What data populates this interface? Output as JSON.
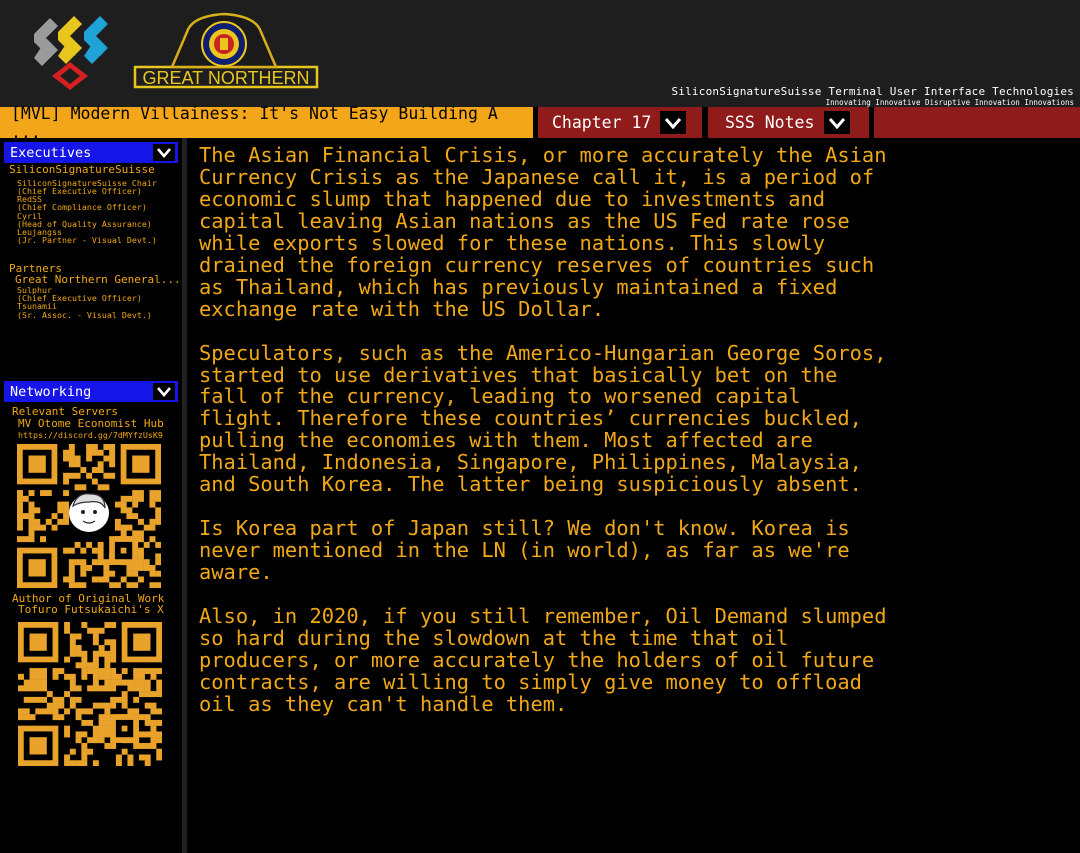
{
  "header": {
    "logo_alt": "SSS logo",
    "publisher_logo_text": "GREAT NORTHERN",
    "company_name": "SiliconSignatureSuisse Terminal User Interface Technologies",
    "company_tagline": "Innovating Innovative Disruptive Innovation Innovations"
  },
  "tabs": {
    "title": "[MVL] Modern Villainess: It's Not Easy Building A ...",
    "chapter": "Chapter 17",
    "notes": "SSS Notes"
  },
  "sidebar": {
    "executives": {
      "label": "Executives",
      "group1": "SiliconSignatureSuisse",
      "group1_items": [
        "SiliconSignatureSuisse Chair",
        "(Chief Executive Officer)",
        "RedSS",
        "(Chief Compliance Officer)",
        "Cyril",
        "(Head of Quality Assurance)",
        "Leujangss",
        "(Jr. Partner - Visual Devt.)"
      ],
      "group2": "Partners",
      "group2_sub": "Great Northern General...",
      "group2_items": [
        "Sulphur",
        "(Chief Executive Officer)",
        "Tsunamii",
        "(Sr. Assoc. - Visual Devt.)"
      ]
    },
    "networking": {
      "label": "Networking",
      "servers_label": "Relevant Servers",
      "server_name": "MV Otome Economist Hub",
      "server_url": "https://discord.gg/7dMYfzUsK9",
      "author_label": "Author of Original Work",
      "author_name": "Tofuro Futsukaichi's X"
    }
  },
  "content": {
    "paragraphs": [
      [
        "The Asian Financial Crisis, or more accurately the Asian",
        "Currency Crisis as the Japanese call it, is a period of",
        "economic slump that happened due to investments and",
        "capital leaving Asian nations as the US Fed rate rose",
        "while exports slowed for these nations. This slowly",
        "drained the foreign currency reserves of countries such",
        "as Thailand, which has previously maintained a fixed",
        "exchange rate with the US Dollar."
      ],
      [
        "Speculators, such as the Americo-Hungarian George Soros,",
        "started to use derivatives that basically bet on the",
        "fall of the currency, leading to worsened capital",
        "flight. Therefore these countries’ currencies buckled,",
        "pulling the economies with them. Most affected are",
        "Thailand, Indonesia, Singapore, Philippines, Malaysia,",
        "and South Korea. The latter being suspiciously absent."
      ],
      [
        "Is Korea part of Japan still? We don't know. Korea is",
        "never mentioned in the LN (in world), as far as we're",
        "aware."
      ],
      [
        "Also, in 2020, if you still remember, Oil Demand slumped",
        "so hard during the slowdown at the time that oil",
        "producers, or more accurately the holders of oil future",
        "contracts, are willing to simply give money to offload",
        "oil as they can't handle them."
      ]
    ]
  },
  "colors": {
    "text": "#f0a818",
    "tab_active": "#f4a61a",
    "tab_inactive": "#8f1b1b",
    "panel_header": "#1515e8",
    "header_bg": "#1e1e1e"
  },
  "icons": {
    "chevron": "chevron-down-icon",
    "qr_server": "qr-code-icon",
    "qr_author": "qr-code-icon"
  }
}
